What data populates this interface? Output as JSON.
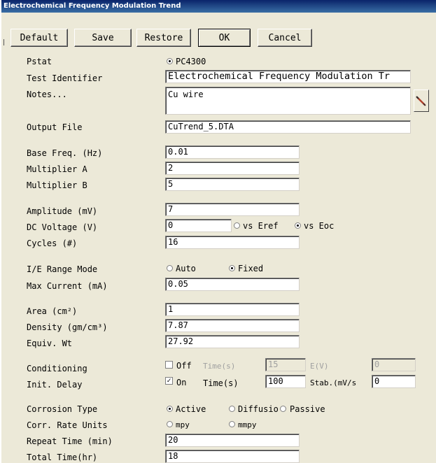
{
  "window": {
    "title": "Electrochemical Frequency Modulation Trend"
  },
  "toolbar": {
    "default_label": "Default",
    "save_label": "Save",
    "restore_label": "Restore",
    "ok_label": "OK",
    "cancel_label": "Cancel"
  },
  "form": {
    "pstat": {
      "label": "Pstat",
      "option": "PC4300"
    },
    "test_identifier": {
      "label": "Test Identifier",
      "value": "Electrochemical Frequency Modulation Tr"
    },
    "notes": {
      "label": "Notes...",
      "value": "Cu wire",
      "edit_icon": "wrench-icon"
    },
    "output_file": {
      "label": "Output File",
      "value": "CuTrend_5.DTA"
    },
    "base_freq": {
      "label": "Base Freq. (Hz)",
      "value": "0.01"
    },
    "multiplier_a": {
      "label": "Multiplier A",
      "value": "2"
    },
    "multiplier_b": {
      "label": "Multiplier B",
      "value": "5"
    },
    "amplitude": {
      "label": "Amplitude (mV)",
      "value": "7"
    },
    "dc_voltage": {
      "label": "DC Voltage (V)",
      "value": "0",
      "opt_eref": "vs Eref",
      "opt_eoc": "vs Eoc",
      "selected": "vs Eoc"
    },
    "cycles": {
      "label": "Cycles (#)",
      "value": "16"
    },
    "ie_range_mode": {
      "label": "I/E Range Mode",
      "opt_auto": "Auto",
      "opt_fixed": "Fixed",
      "selected": "Fixed"
    },
    "max_current": {
      "label": "Max Current (mA)",
      "value": "0.05"
    },
    "area": {
      "label": "Area (cm²)",
      "value": "1"
    },
    "density": {
      "label": "Density (gm/cm³)",
      "value": "7.87"
    },
    "equiv_wt": {
      "label": "Equiv. Wt",
      "value": "27.92"
    },
    "conditioning": {
      "label": "Conditioning",
      "check_label": "Off",
      "checked": false,
      "time_label": "Time(s)",
      "time_value": "15",
      "e_label": "E(V)",
      "e_value": "0"
    },
    "init_delay": {
      "label": "Init. Delay",
      "check_label": "On",
      "checked": true,
      "time_label": "Time(s)",
      "time_value": "100",
      "stab_label": "Stab.(mV/s",
      "stab_value": "0"
    },
    "corrosion_type": {
      "label": "Corrosion Type",
      "opt_active": "Active",
      "opt_diffusion": "Diffusio",
      "opt_passive": "Passive",
      "selected": "Active"
    },
    "corr_rate_units": {
      "label": "Corr. Rate Units",
      "opt_mpy": "mpy",
      "opt_mmpy": "mmpy",
      "selected": "none"
    },
    "repeat_time": {
      "label": "Repeat Time (min)",
      "value": "20"
    },
    "total_time": {
      "label": "Total Time(hr)",
      "value": "18"
    }
  },
  "colors": {
    "titlebar_start": "#0a246a",
    "titlebar_end": "#3a6ea5",
    "face": "#ece9d8",
    "field_bg": "#ffffff"
  }
}
